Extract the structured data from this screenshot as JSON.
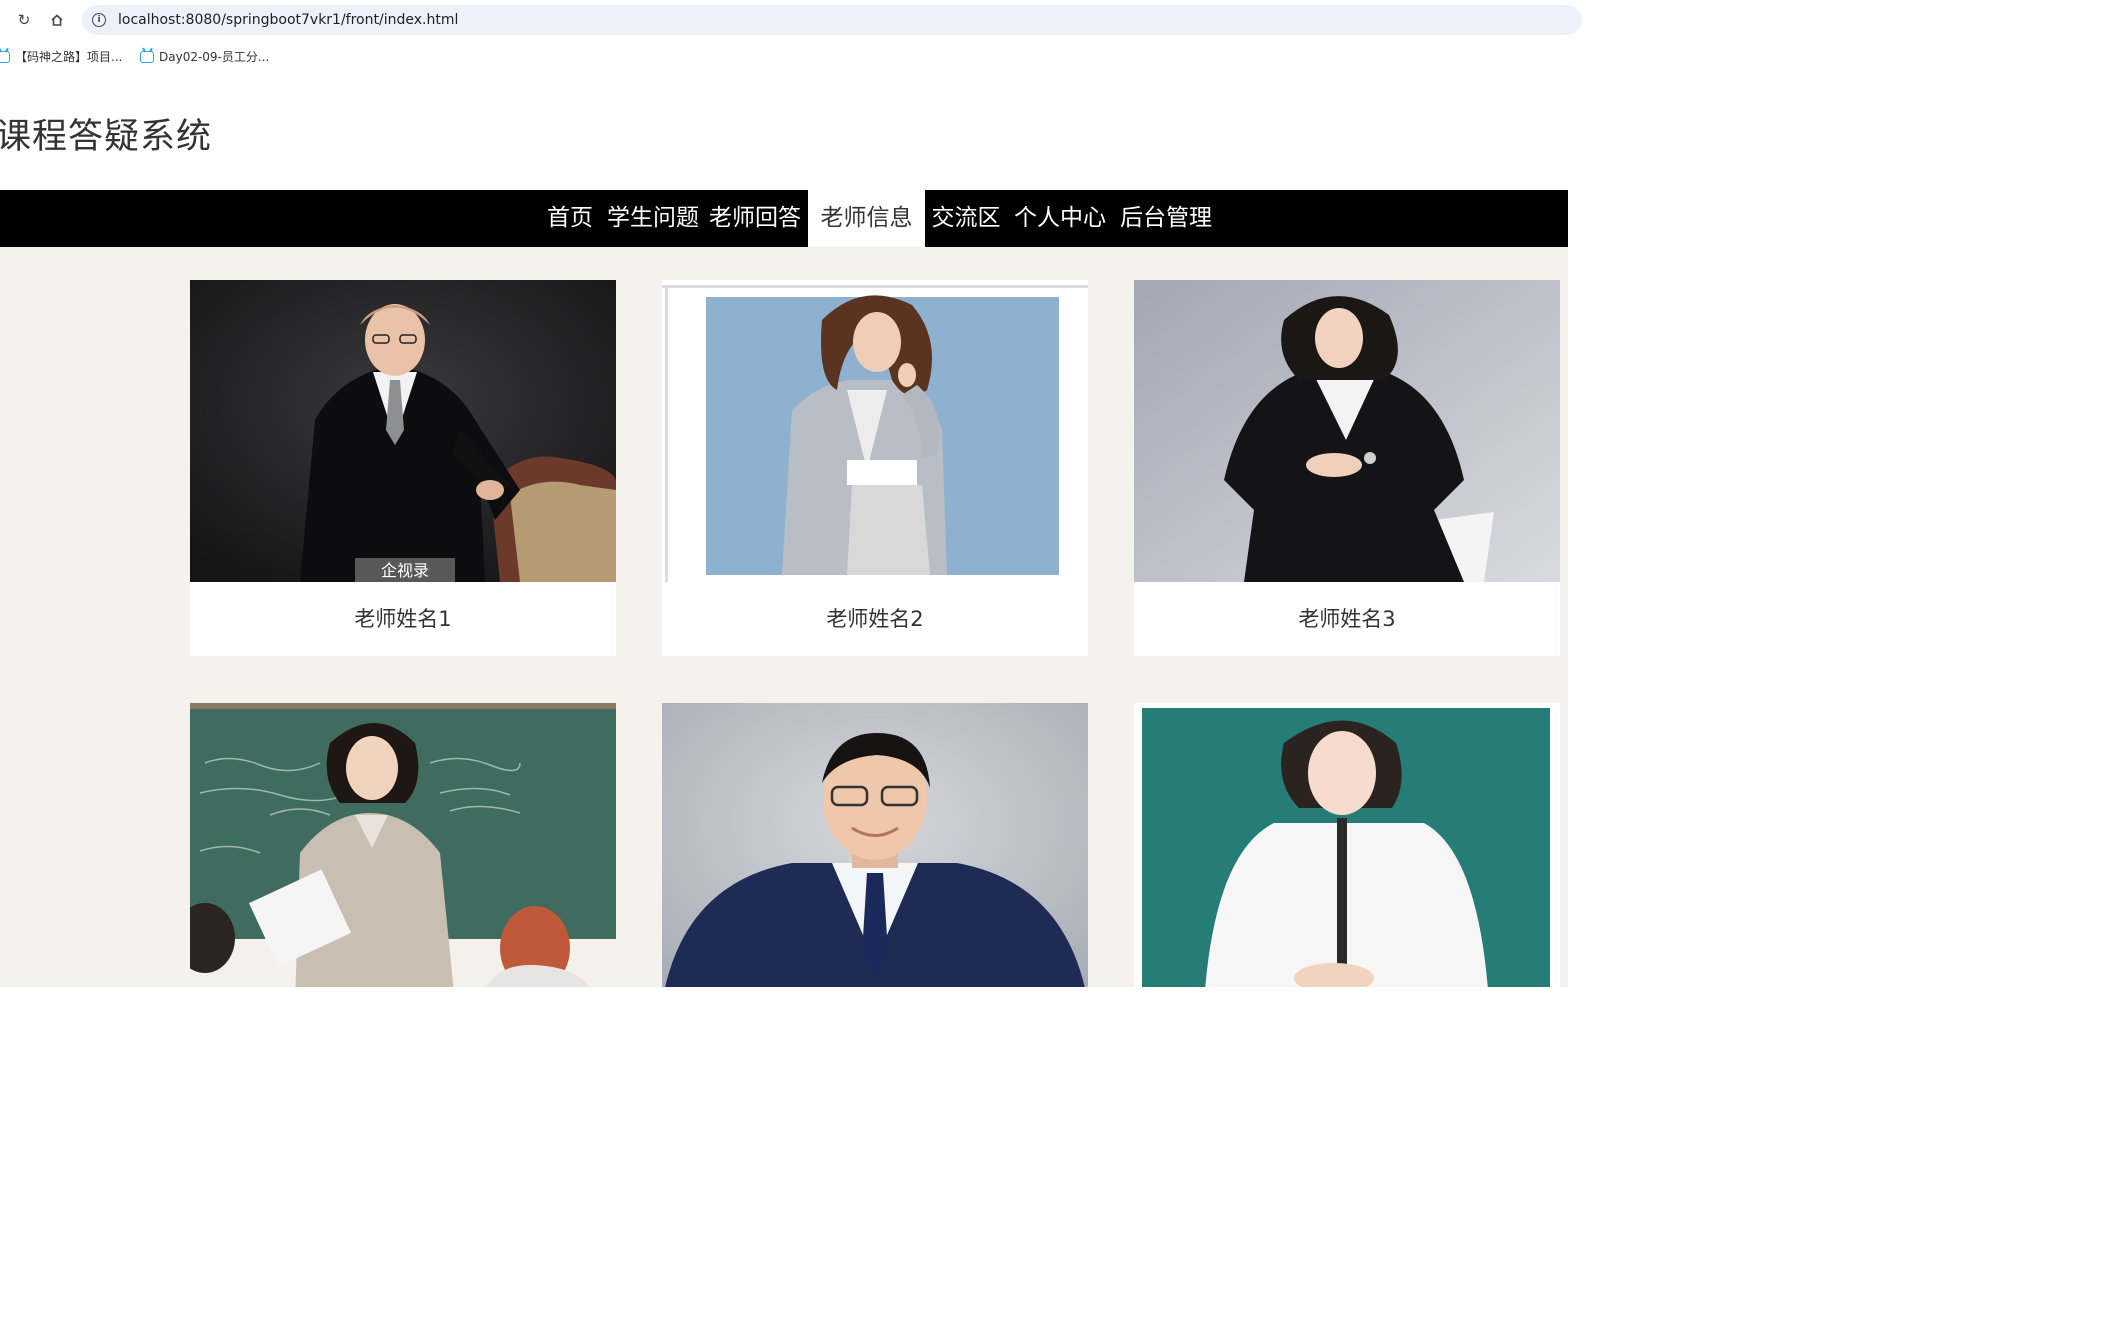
{
  "browser": {
    "url": "localhost:8080/springboot7vkr1/front/index.html",
    "bookmarks": [
      {
        "label": "【码神之路】项目..."
      },
      {
        "label": "Day02-09-员工分..."
      }
    ]
  },
  "site": {
    "title": "课程答疑系统"
  },
  "nav": {
    "items": [
      {
        "label": "首页"
      },
      {
        "label": "学生问题"
      },
      {
        "label": "老师回答"
      },
      {
        "label": "老师信息"
      },
      {
        "label": "交流区"
      },
      {
        "label": "个人中心"
      },
      {
        "label": "后台管理"
      }
    ],
    "active": "老师信息"
  },
  "teachers": [
    {
      "name": "老师姓名1"
    },
    {
      "name": "老师姓名2"
    },
    {
      "name": "老师姓名3"
    },
    {
      "name": ""
    },
    {
      "name": ""
    },
    {
      "name": ""
    }
  ],
  "watermark": "企视录"
}
